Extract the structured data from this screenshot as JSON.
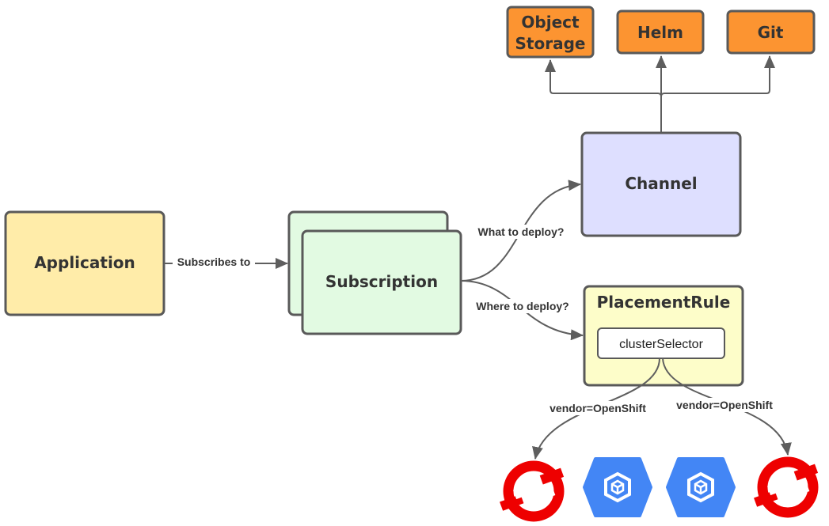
{
  "nodes": {
    "object_storage": [
      "Object",
      "Storage"
    ],
    "helm": "Helm",
    "git": "Git",
    "channel": "Channel",
    "application": "Application",
    "subscription": "Subscription",
    "placement_rule": "PlacementRule",
    "cluster_selector": "clusterSelector"
  },
  "edges": {
    "subscribes_to": "Subscribes to",
    "what_to_deploy": "What to deploy?",
    "where_to_deploy": "Where to deploy?",
    "vendor_left": "vendor=OpenShift",
    "vendor_right": "vendor=OpenShift"
  },
  "icons": [
    "openshift-icon",
    "gke-icon",
    "gke-icon",
    "openshift-icon"
  ],
  "colors": {
    "source": "#fc9431",
    "channel": "#dedfff",
    "application": "#ffeca9",
    "subscription": "#e2fae2",
    "placement": "#fdfdc9",
    "openshift": "#ee0000",
    "gke": "#4386f5"
  }
}
